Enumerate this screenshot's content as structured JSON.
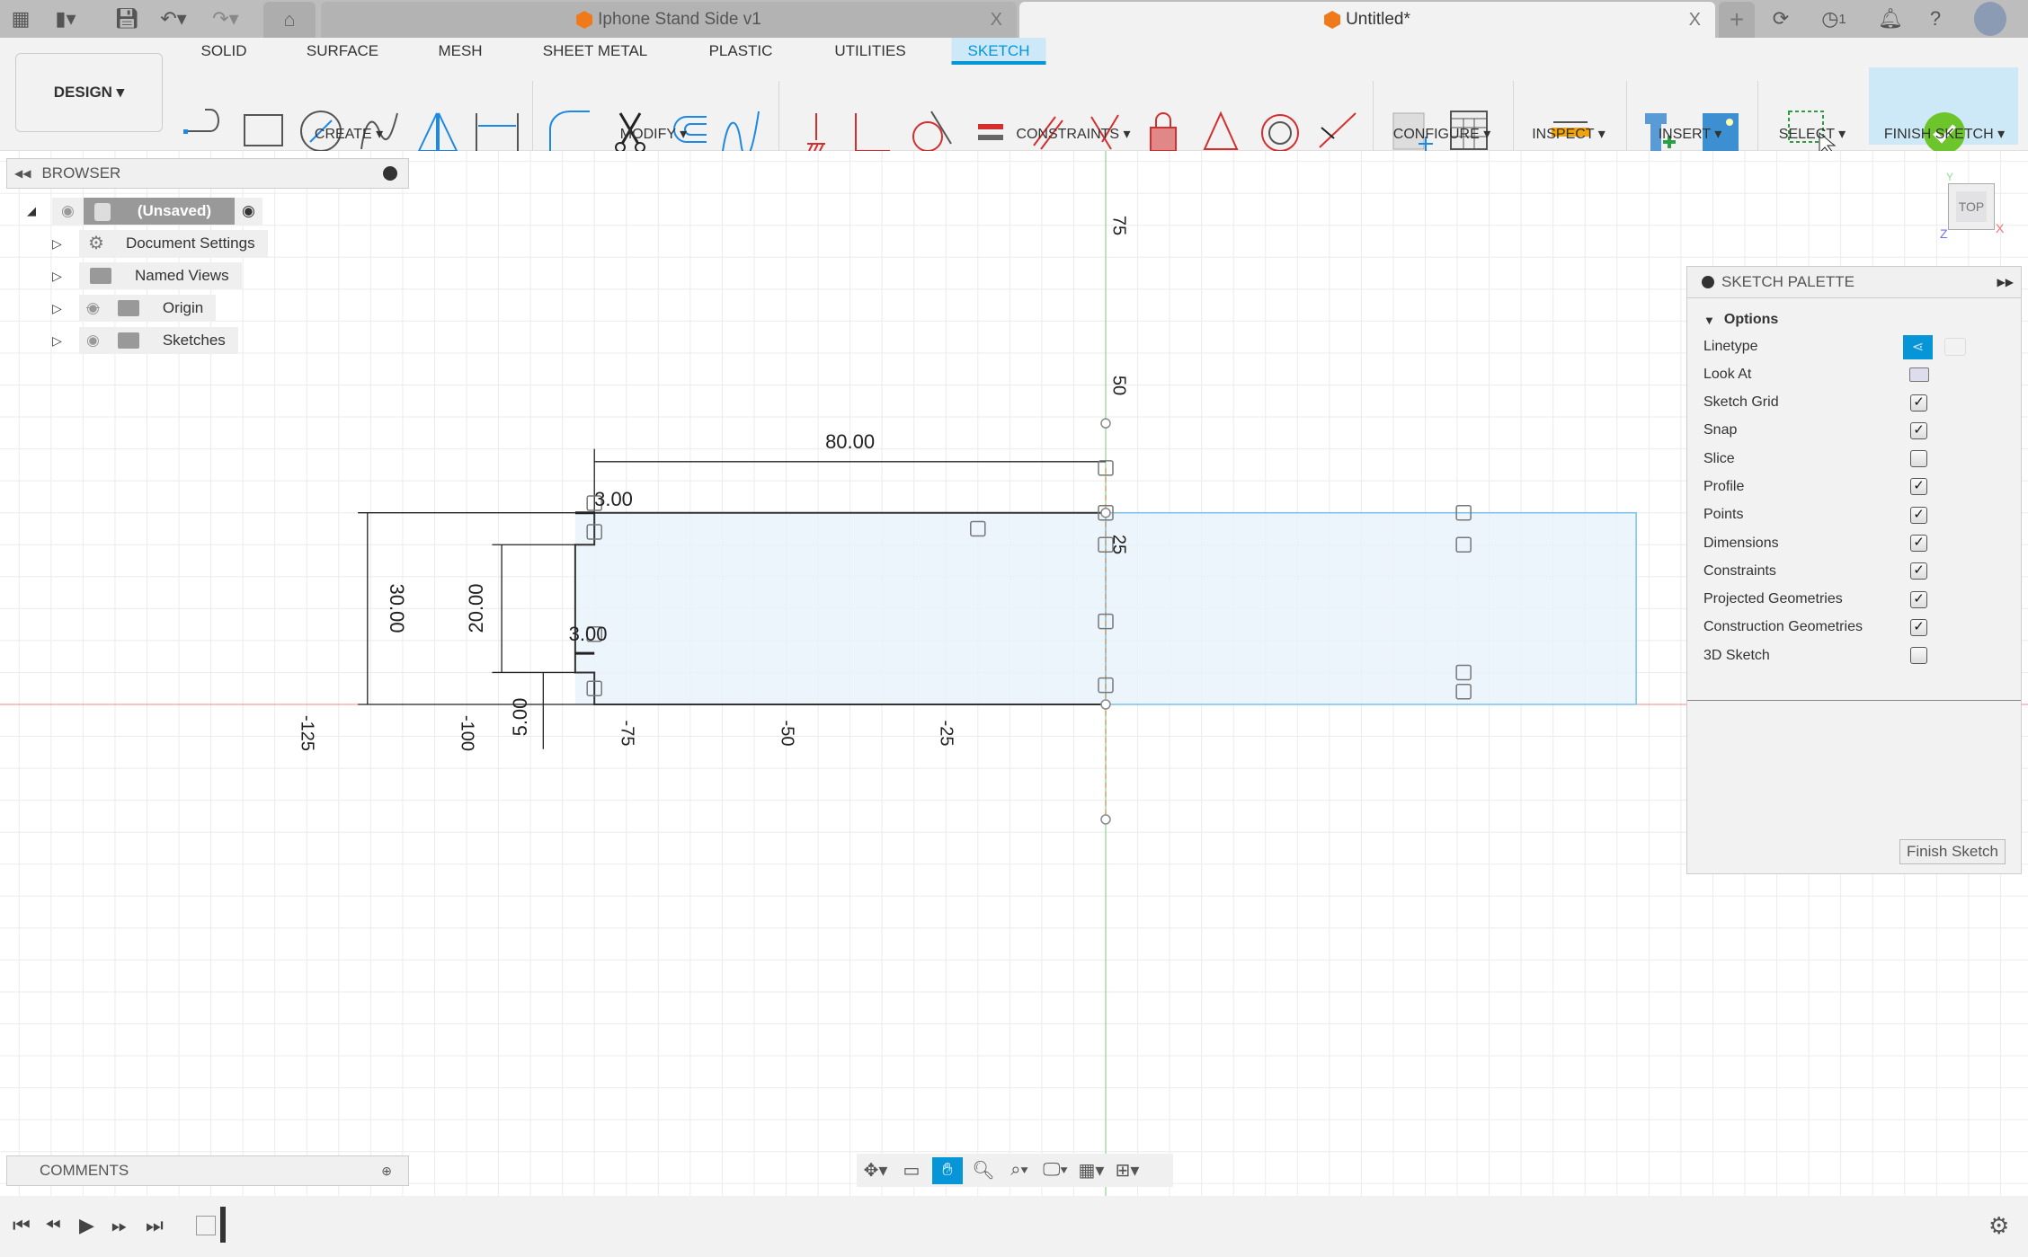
{
  "titlebar": {
    "tabs": [
      {
        "title": "Iphone Stand Side v1",
        "active": false
      },
      {
        "title": "Untitled*",
        "active": true
      }
    ],
    "close_glyph": "X",
    "new_tab_glyph": "+",
    "job_count": "1",
    "icons": [
      "apps-grid-icon",
      "file-icon",
      "save-icon",
      "undo-icon",
      "redo-icon",
      "home-icon",
      "sync-icon",
      "job-status-icon",
      "notifications-bell-icon",
      "help-icon",
      "user-avatar"
    ]
  },
  "toolbar": {
    "workspace": "DESIGN",
    "tabs": [
      "SOLID",
      "SURFACE",
      "MESH",
      "SHEET METAL",
      "PLASTIC",
      "UTILITIES",
      "SKETCH"
    ],
    "active_tab": "SKETCH",
    "groups": {
      "create": "CREATE",
      "modify": "MODIFY",
      "constraints": "CONSTRAINTS",
      "configure": "CONFIGURE",
      "inspect": "INSPECT",
      "insert": "INSERT",
      "select": "SELECT",
      "finish": "FINISH SKETCH"
    },
    "accent": "#0696d7"
  },
  "browser": {
    "title": "BROWSER",
    "root": "(Unsaved)",
    "items": [
      {
        "label": "Document Settings",
        "icon": "gear-icon",
        "visible": null
      },
      {
        "label": "Named Views",
        "icon": "folder-icon",
        "visible": null
      },
      {
        "label": "Origin",
        "icon": "folder-icon",
        "visible": false
      },
      {
        "label": "Sketches",
        "icon": "folder-icon",
        "visible": true
      }
    ]
  },
  "comments": {
    "title": "COMMENTS"
  },
  "viewcube": {
    "face": "TOP",
    "x": "X",
    "y": "Y",
    "z": "Z"
  },
  "sketch": {
    "dimensions": {
      "width": "80.00",
      "height": "30.00",
      "notch_height": "20.00",
      "notch_offset": "5.00",
      "notch_depth_top": "3.00",
      "notch_depth_bottom": "3.00"
    },
    "axis_ticks_x": [
      "-125",
      "-100",
      "-75",
      "-50",
      "-25"
    ],
    "axis_ticks_y": [
      "75",
      "50",
      "25"
    ]
  },
  "palette": {
    "title": "SKETCH PALETTE",
    "section": "Options",
    "linetype_label": "Linetype",
    "look_at_label": "Look At",
    "options": [
      {
        "label": "Sketch Grid",
        "checked": true
      },
      {
        "label": "Snap",
        "checked": true
      },
      {
        "label": "Slice",
        "checked": false
      },
      {
        "label": "Profile",
        "checked": true
      },
      {
        "label": "Points",
        "checked": true
      },
      {
        "label": "Dimensions",
        "checked": true
      },
      {
        "label": "Constraints",
        "checked": true
      },
      {
        "label": "Projected Geometries",
        "checked": true
      },
      {
        "label": "Construction Geometries",
        "checked": true
      },
      {
        "label": "3D Sketch",
        "checked": false
      }
    ],
    "finish_button": "Finish Sketch"
  }
}
